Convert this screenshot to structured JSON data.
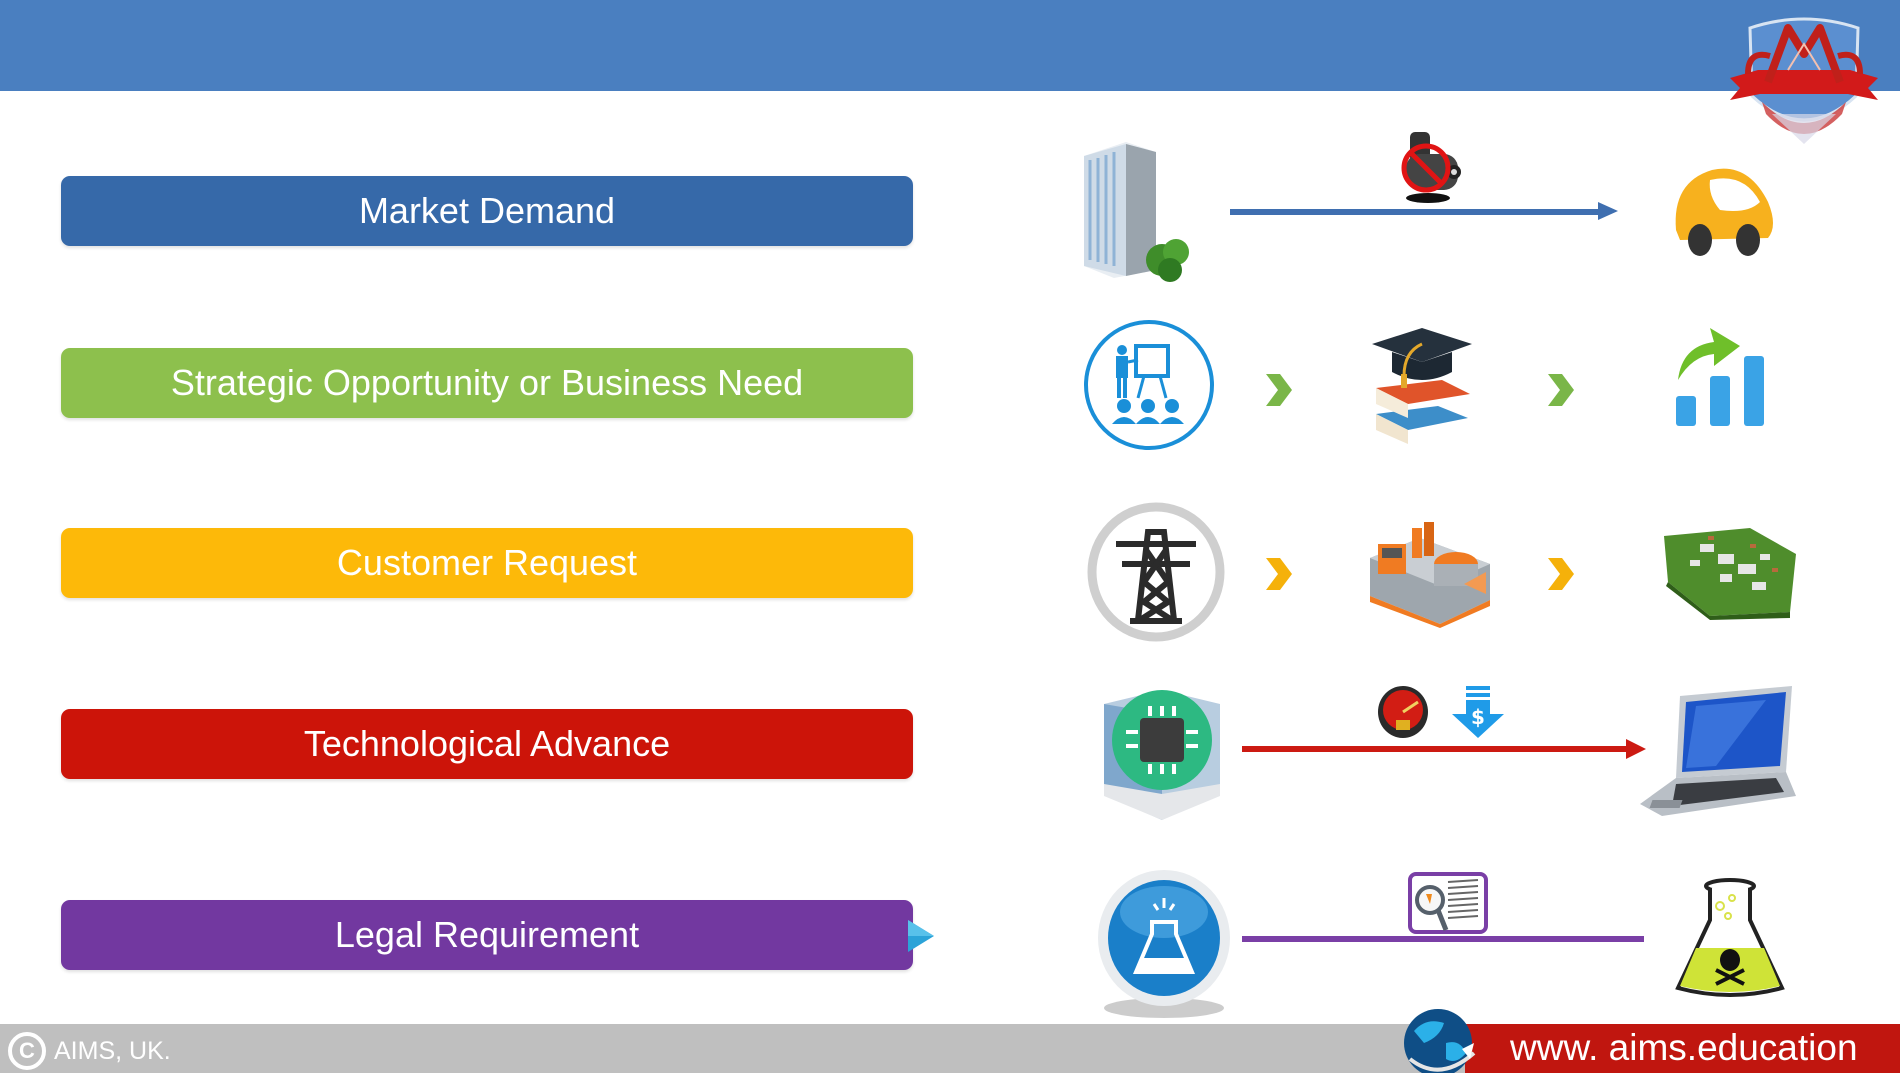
{
  "header": {
    "logo": "aims-crest-logo"
  },
  "rows": [
    {
      "label": "Market Demand",
      "color": "#3669a9",
      "icons": [
        "office-building-icon",
        "no-oil-barrel-icon",
        "yellow-car-icon"
      ],
      "connector": "arrow",
      "connector_color": "#3f6fb0"
    },
    {
      "label": "Strategic Opportunity or Business Need",
      "color": "#8dc04d",
      "icons": [
        "training-presentation-icon",
        "graduation-books-icon",
        "growth-chart-icon"
      ],
      "connector": "chevrons",
      "connector_color": "#7ab648"
    },
    {
      "label": "Customer Request",
      "color": "#fdb909",
      "icons": [
        "power-tower-icon",
        "power-plant-icon",
        "industrial-park-icon"
      ],
      "connector": "chevrons",
      "connector_color": "#f5b10a"
    },
    {
      "label": "Technological Advance",
      "color": "#cc1409",
      "icons": [
        "chip-building-icon",
        "speed-gauge-icon",
        "price-down-icon",
        "laptop-icon"
      ],
      "connector": "arrow",
      "connector_color": "#cc1a12"
    },
    {
      "label": "Legal Requirement",
      "color": "#7238a0",
      "icons": [
        "science-flask-button-icon",
        "law-review-icon",
        "toxic-flask-icon"
      ],
      "connector": "line",
      "connector_color": "#7a3fa6"
    }
  ],
  "footer": {
    "copyright_symbol": "C",
    "copyright_text": "AIMS, UK.",
    "url": "www. aims.education"
  }
}
